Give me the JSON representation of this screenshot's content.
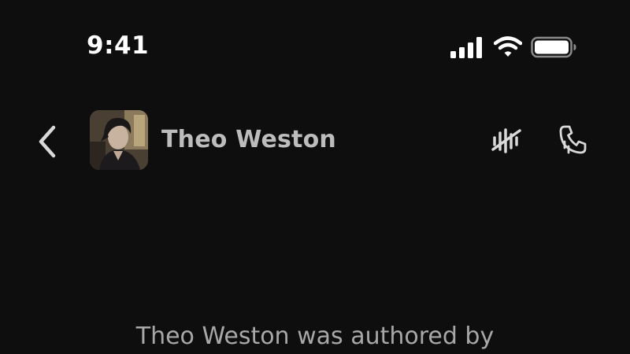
{
  "status_bar": {
    "time": "9:41",
    "icons": [
      "cellular-signal-icon",
      "wifi-icon",
      "battery-icon"
    ]
  },
  "header": {
    "back_icon": "chevron-left-icon",
    "contact_name": "Theo Weston",
    "actions": [
      "voice-off-icon",
      "phone-call-icon"
    ]
  },
  "chat": {
    "author_note": "Theo Weston was authored by"
  },
  "colors": {
    "background": "#0e0e0f",
    "name_text": "#bdbdbd",
    "note_text": "#a8a8a8",
    "icon": "#d9d9d9"
  }
}
